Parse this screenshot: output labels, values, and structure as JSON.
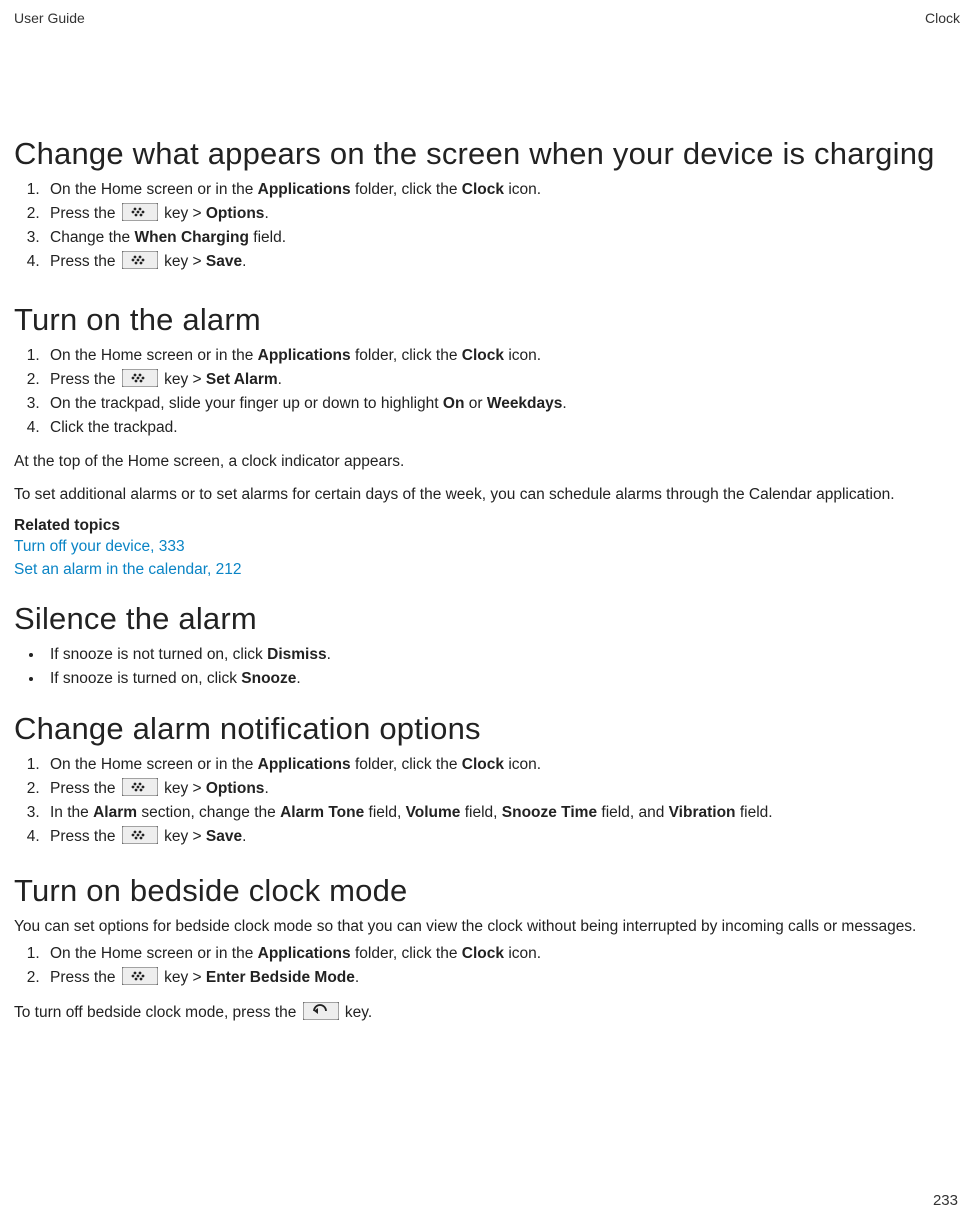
{
  "header": {
    "left": "User Guide",
    "right": "Clock"
  },
  "sections": {
    "s1": {
      "title": "Change what appears on the screen when your device is charging",
      "steps": {
        "i1a": "On the Home screen or in the ",
        "i1b": " folder, click the ",
        "i1c": " icon.",
        "applications": "Applications",
        "clock": "Clock",
        "i2a": "Press the ",
        "i2b": " key > ",
        "i2c": ".",
        "options": "Options",
        "i3a": "Change the ",
        "i3b": " field.",
        "whenCharging": "When Charging",
        "i4a": "Press the ",
        "i4b": " key > ",
        "i4c": ".",
        "save": "Save"
      }
    },
    "s2": {
      "title": "Turn on the alarm",
      "steps": {
        "i1a": "On the Home screen or in the ",
        "i1b": " folder, click the ",
        "i1c": " icon.",
        "applications": "Applications",
        "clock": "Clock",
        "i2a": "Press the ",
        "i2b": " key > ",
        "i2c": ".",
        "setAlarm": "Set Alarm",
        "i3a": "On the trackpad, slide your finger up or down to highlight ",
        "i3b": " or ",
        "i3c": ".",
        "on": "On",
        "weekdays": "Weekdays",
        "i4": "Click the trackpad."
      },
      "para1": "At the top of the Home screen, a clock indicator appears.",
      "para2": "To set additional alarms or to set alarms for certain days of the week, you can schedule alarms through the Calendar application.",
      "relatedHeading": "Related topics",
      "link1": "Turn off your device, 333",
      "link2": "Set an alarm in the calendar, 212"
    },
    "s3": {
      "title": "Silence the alarm",
      "b1a": "If snooze is not turned on, click ",
      "b1b": ".",
      "dismiss": "Dismiss",
      "b2a": "If snooze is turned on, click ",
      "b2b": ".",
      "snooze": "Snooze"
    },
    "s4": {
      "title": "Change alarm notification options",
      "steps": {
        "i1a": "On the Home screen or in the ",
        "i1b": " folder, click the ",
        "i1c": " icon.",
        "applications": "Applications",
        "clock": "Clock",
        "i2a": "Press the ",
        "i2b": " key > ",
        "i2c": ".",
        "options": "Options",
        "i3a": "In the ",
        "i3b": " section, change the ",
        "i3c": " field, ",
        "i3d": " field, ",
        "i3e": " field, and ",
        "i3f": " field.",
        "alarm": "Alarm",
        "alarmTone": "Alarm Tone",
        "volume": "Volume",
        "snoozeTime": "Snooze Time",
        "vibration": "Vibration",
        "i4a": "Press the ",
        "i4b": " key > ",
        "i4c": ".",
        "save": "Save"
      }
    },
    "s5": {
      "title": "Turn on bedside clock mode",
      "intro": "You can set options for bedside clock mode so that you can view the clock without being interrupted by incoming calls or messages.",
      "steps": {
        "i1a": "On the Home screen or in the ",
        "i1b": " folder, click the ",
        "i1c": " icon.",
        "applications": "Applications",
        "clock": "Clock",
        "i2a": "Press the ",
        "i2b": " key > ",
        "i2c": ".",
        "enterBedside": "Enter Bedside Mode"
      },
      "outroA": "To turn off bedside clock mode, press the ",
      "outroB": " key."
    }
  },
  "pageNumber": "233"
}
